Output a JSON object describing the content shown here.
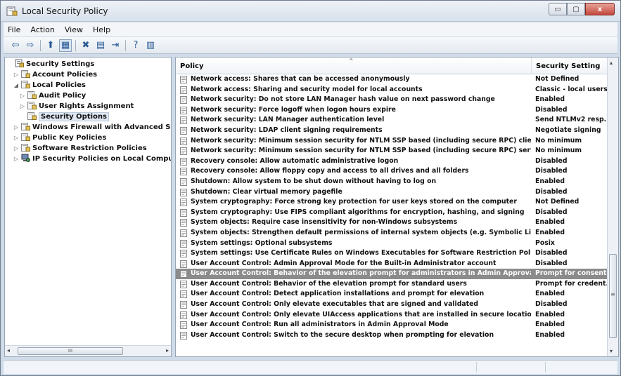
{
  "window": {
    "title": "Local Security Policy",
    "minimize": "▭",
    "maximize": "▢",
    "close": "x"
  },
  "menu": [
    "File",
    "Action",
    "View",
    "Help"
  ],
  "toolbar": {
    "icons": [
      "back-icon",
      "forward-icon",
      "up-icon",
      "show-hide-tree-icon",
      "delete-icon",
      "properties-icon",
      "export-icon",
      "help-icon",
      "show-action-pane-icon"
    ],
    "glyphs": [
      "⇦",
      "⇨",
      "⬆",
      "▦",
      "✖",
      "▤",
      "⇥",
      "?",
      "▥"
    ]
  },
  "tree": [
    {
      "label": "Security Settings",
      "level": 0,
      "expander": "",
      "icon": "security-settings-icon"
    },
    {
      "label": "Account Policies",
      "level": 1,
      "expander": "▷",
      "icon": "folder-icon"
    },
    {
      "label": "Local Policies",
      "level": 1,
      "expander": "◢",
      "icon": "folder-icon"
    },
    {
      "label": "Audit Policy",
      "level": 2,
      "expander": "▷",
      "icon": "folder-icon"
    },
    {
      "label": "User Rights Assignment",
      "level": 2,
      "expander": "▷",
      "icon": "folder-icon"
    },
    {
      "label": "Security Options",
      "level": 2,
      "expander": "",
      "icon": "folder-icon",
      "selected": true
    },
    {
      "label": "Windows Firewall with Advanced Secu",
      "level": 1,
      "expander": "▷",
      "icon": "folder-icon"
    },
    {
      "label": "Public Key Policies",
      "level": 1,
      "expander": "▷",
      "icon": "folder-icon"
    },
    {
      "label": "Software Restriction Policies",
      "level": 1,
      "expander": "▷",
      "icon": "folder-icon"
    },
    {
      "label": "IP Security Policies on Local Computer",
      "level": 1,
      "expander": "▷",
      "icon": "ip-security-icon"
    }
  ],
  "tree_scroll": {
    "left": "◂",
    "right": "▸",
    "grip": "III"
  },
  "columns": {
    "policy": "Policy",
    "setting": "Security Setting",
    "sort_arrow": "^"
  },
  "rows": [
    {
      "policy": "Network access: Shares that can be accessed anonymously",
      "setting": "Not Defined"
    },
    {
      "policy": "Network access: Sharing and security model for local accounts",
      "setting": "Classic - local users..."
    },
    {
      "policy": "Network security: Do not store LAN Manager hash value on next password change",
      "setting": "Enabled"
    },
    {
      "policy": "Network security: Force logoff when logon hours expire",
      "setting": "Disabled"
    },
    {
      "policy": "Network security: LAN Manager authentication level",
      "setting": "Send NTLMv2 resp..."
    },
    {
      "policy": "Network security: LDAP client signing requirements",
      "setting": "Negotiate signing"
    },
    {
      "policy": "Network security: Minimum session security for NTLM SSP based (including secure RPC) clients",
      "setting": "No minimum"
    },
    {
      "policy": "Network security: Minimum session security for NTLM SSP based (including secure RPC) servers",
      "setting": "No minimum"
    },
    {
      "policy": "Recovery console: Allow automatic administrative logon",
      "setting": "Disabled"
    },
    {
      "policy": "Recovery console: Allow floppy copy and access to all drives and all folders",
      "setting": "Disabled"
    },
    {
      "policy": "Shutdown: Allow system to be shut down without having to log on",
      "setting": "Enabled"
    },
    {
      "policy": "Shutdown: Clear virtual memory pagefile",
      "setting": "Disabled"
    },
    {
      "policy": "System cryptography: Force strong key protection for user keys stored on the computer",
      "setting": "Not Defined"
    },
    {
      "policy": "System cryptography: Use FIPS compliant algorithms for encryption, hashing, and signing",
      "setting": "Disabled"
    },
    {
      "policy": "System objects: Require case insensitivity for non-Windows subsystems",
      "setting": "Enabled"
    },
    {
      "policy": "System objects: Strengthen default permissions of internal system objects (e.g. Symbolic Links)",
      "setting": "Enabled"
    },
    {
      "policy": "System settings: Optional subsystems",
      "setting": "Posix"
    },
    {
      "policy": "System settings: Use Certificate Rules on Windows Executables for Software Restriction Policies",
      "setting": "Disabled"
    },
    {
      "policy": "User Account Control: Admin Approval Mode for the Built-in Administrator account",
      "setting": "Disabled"
    },
    {
      "policy": "User Account Control: Behavior of the elevation prompt for administrators in Admin Approval Mode",
      "setting": "Prompt for consent",
      "selected": true
    },
    {
      "policy": "User Account Control: Behavior of the elevation prompt for standard users",
      "setting": "Prompt for credent..."
    },
    {
      "policy": "User Account Control: Detect application installations and prompt for elevation",
      "setting": "Enabled"
    },
    {
      "policy": "User Account Control: Only elevate executables that are signed and validated",
      "setting": "Disabled"
    },
    {
      "policy": "User Account Control: Only elevate UIAccess applications that are installed in secure locations",
      "setting": "Enabled"
    },
    {
      "policy": "User Account Control: Run all administrators in Admin Approval Mode",
      "setting": "Enabled"
    },
    {
      "policy": "User Account Control: Switch to the secure desktop when prompting for elevation",
      "setting": "Enabled"
    }
  ],
  "list_scroll": {
    "up": "▴",
    "down": "▾",
    "grip": "≡"
  },
  "colors": {
    "selection": "#8b8b8b",
    "pane_border": "#98a6b6",
    "frame": "#cfdbe8"
  }
}
